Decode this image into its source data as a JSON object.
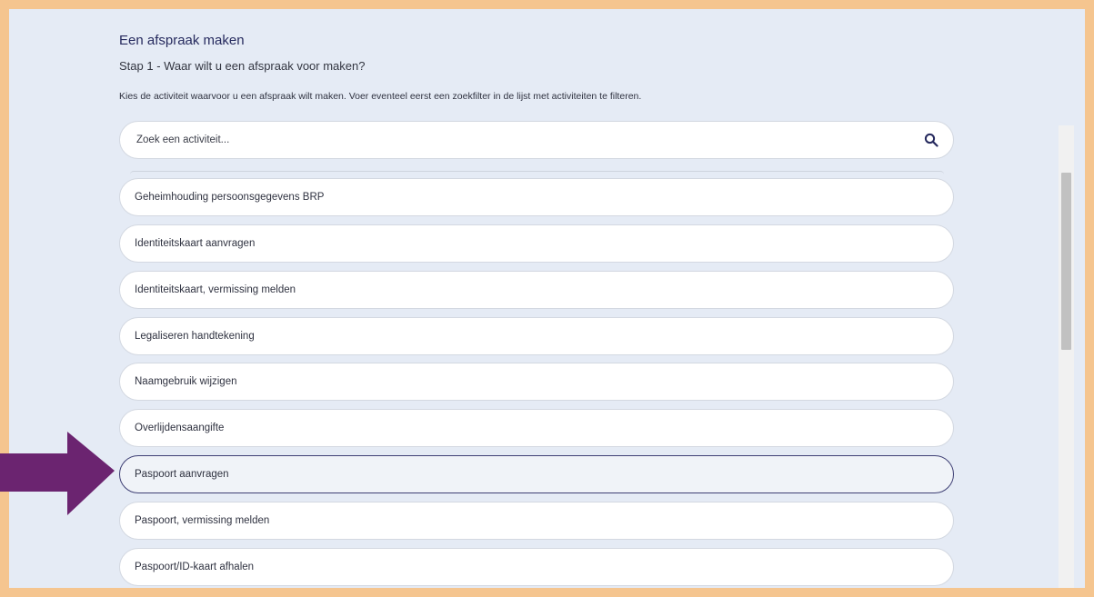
{
  "page": {
    "title": "Een afspraak maken",
    "step": "Stap 1 - Waar wilt u een afspraak voor maken?",
    "instruction": "Kies de activiteit waarvoor u een afspraak wilt maken. Voer eventeel eerst een zoekfilter in de lijst met activiteiten te filteren."
  },
  "search": {
    "placeholder": "Zoek een activiteit...",
    "value": "",
    "icon": "search-icon"
  },
  "activities": [
    {
      "label": "Geheimhouding persoonsgegevens BRP"
    },
    {
      "label": "Identiteitskaart aanvragen"
    },
    {
      "label": "Identiteitskaart, vermissing melden"
    },
    {
      "label": "Legaliseren handtekening"
    },
    {
      "label": "Naamgebruik wijzigen"
    },
    {
      "label": "Overlijdensaangifte"
    },
    {
      "label": "Paspoort aanvragen",
      "highlighted": true
    },
    {
      "label": "Paspoort, vermissing melden"
    },
    {
      "label": "Paspoort/ID-kaart afhalen"
    }
  ],
  "colors": {
    "frame_border": "#f5c58f",
    "background": "#e5ebf5",
    "title": "#262a5e",
    "arrow": "#6b2470",
    "highlight_border": "#3e3f74"
  }
}
